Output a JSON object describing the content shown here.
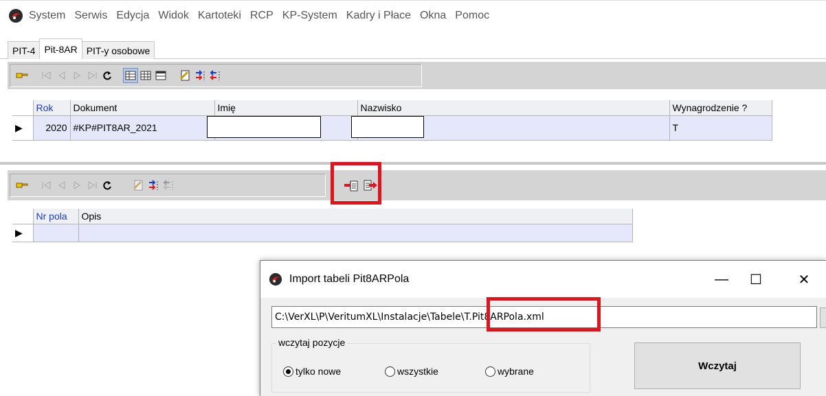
{
  "menu": [
    "System",
    "Serwis",
    "Edycja",
    "Widok",
    "Kartoteki",
    "RCP",
    "KP-System",
    "Kadry i Płace",
    "Okna",
    "Pomoc"
  ],
  "tabs": [
    {
      "label": "PIT-4",
      "active": false
    },
    {
      "label": "Pit-8AR",
      "active": true
    },
    {
      "label": "PIT-y osobowe",
      "active": false
    }
  ],
  "top_grid": {
    "columns": [
      "Rok",
      "Dokument",
      "Imię",
      "Nazwisko",
      "Wynagrodzenie ?"
    ],
    "rows": [
      {
        "rok": "2020",
        "dokument": "#KP#PIT8AR_2021",
        "imie": "",
        "nazwisko": "",
        "wynagrodzenie": "T"
      }
    ]
  },
  "bottom_grid": {
    "columns": [
      "Nr pola",
      "Opis"
    ]
  },
  "dialog": {
    "title": "Import tabeli Pit8ARPola",
    "path": "C:\\VerXL\\P\\VeritumXL\\Instalacje\\Tabele\\T.Pit8ARPola.xml",
    "browse": "...",
    "group_label": "wczytaj pozycje",
    "options": [
      "tylko nowe",
      "wszystkie",
      "wybrane"
    ],
    "selected": "tylko nowe",
    "load_button": "Wczytaj",
    "minimize": "—",
    "maximize": "☐",
    "close": "✕"
  },
  "colors": {
    "highlight": "#e0141c",
    "row_bg": "#e4e8fa",
    "toolbar_bg": "#d4d4d4"
  }
}
